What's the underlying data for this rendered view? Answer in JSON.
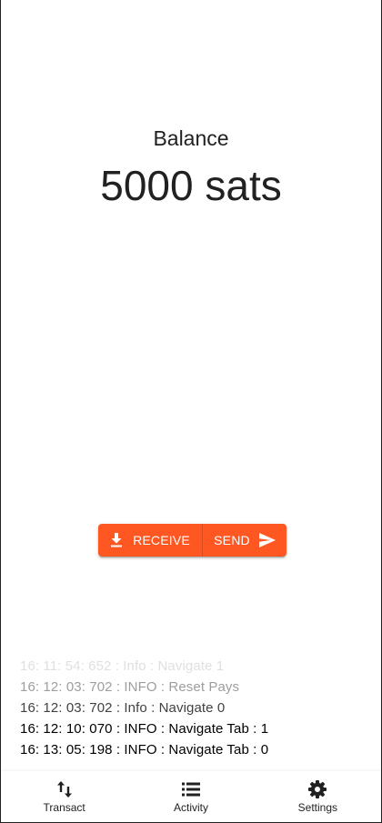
{
  "balance": {
    "label": "Balance",
    "amount": "5000 sats"
  },
  "actions": {
    "receive_label": "RECEIVE",
    "send_label": "SEND",
    "receive_icon": "download-icon",
    "send_icon": "send-icon",
    "accent_color": "#ff5722"
  },
  "log": [
    {
      "text": "16: 11: 54: 652 : Info : Navigate 1",
      "color": "#e0e0e0"
    },
    {
      "text": "16: 12: 03: 702 : INFO : Reset Pays",
      "color": "#9e9e9e"
    },
    {
      "text": "16: 12: 03: 702 : Info : Navigate 0",
      "color": "#424242"
    },
    {
      "text": "16: 12: 10: 070 : INFO : Navigate Tab : 1",
      "color": "#000000"
    },
    {
      "text": "16: 13: 05: 198 : INFO : Navigate Tab : 0",
      "color": "#000000"
    }
  ],
  "nav": {
    "items": [
      {
        "label": "Transact",
        "icon": "swap-vertical-icon"
      },
      {
        "label": "Activity",
        "icon": "list-icon"
      },
      {
        "label": "Settings",
        "icon": "gear-icon"
      }
    ]
  }
}
